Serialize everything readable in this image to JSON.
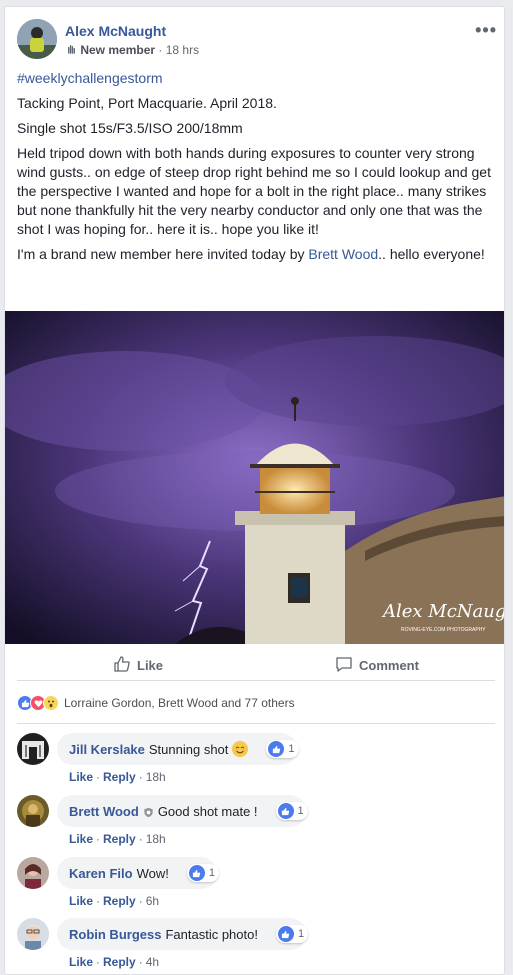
{
  "post": {
    "author": "Alex McNaught",
    "badge": "New member",
    "time": "18 hrs",
    "more_glyph": "•••",
    "hashtag": "#weeklychallengestorm",
    "line_location": "Tacking Point, Port Macquarie. April 2018.",
    "line_settings": "Single shot 15s/F3.5/ISO 200/18mm",
    "line_story": "Held tripod down with both hands during exposures to counter very strong wind gusts.. on edge of steep drop right behind me so I could lookup and get the perspective I wanted and hope for a bolt in the right place.. many strikes but none thankfully hit the very nearby conductor and only one that was the shot I was hoping for.. here it is.. hope you like it!",
    "intro_before": "I'm a brand new member here invited today by ",
    "intro_mention": "Brett Wood",
    "intro_after": ".. hello everyone!",
    "photo_signature": "Alex McNaught",
    "photo_credit": "ROVING-EYE.COM PHOTOGRAPHY"
  },
  "actions": {
    "like_label": "Like",
    "comment_label": "Comment"
  },
  "reactions": {
    "summary": "Lorraine Gordon, Brett Wood and 77 others"
  },
  "comments": [
    {
      "name": "Jill Kerslake",
      "text": "Stunning shot",
      "likes": "1",
      "like_label": "Like",
      "reply_label": "Reply",
      "time": "18h"
    },
    {
      "name": "Brett Wood",
      "text": "Good shot mate !",
      "likes": "1",
      "like_label": "Like",
      "reply_label": "Reply",
      "time": "18h"
    },
    {
      "name": "Karen Filo",
      "text": "Wow!",
      "likes": "1",
      "like_label": "Like",
      "reply_label": "Reply",
      "time": "6h"
    },
    {
      "name": "Robin Burgess",
      "text": "Fantastic photo!",
      "likes": "1",
      "like_label": "Like",
      "reply_label": "Reply",
      "time": "4h"
    }
  ],
  "colors": {
    "link": "#385898",
    "like_blue": "#4b7bec",
    "love_red": "#f25268"
  }
}
